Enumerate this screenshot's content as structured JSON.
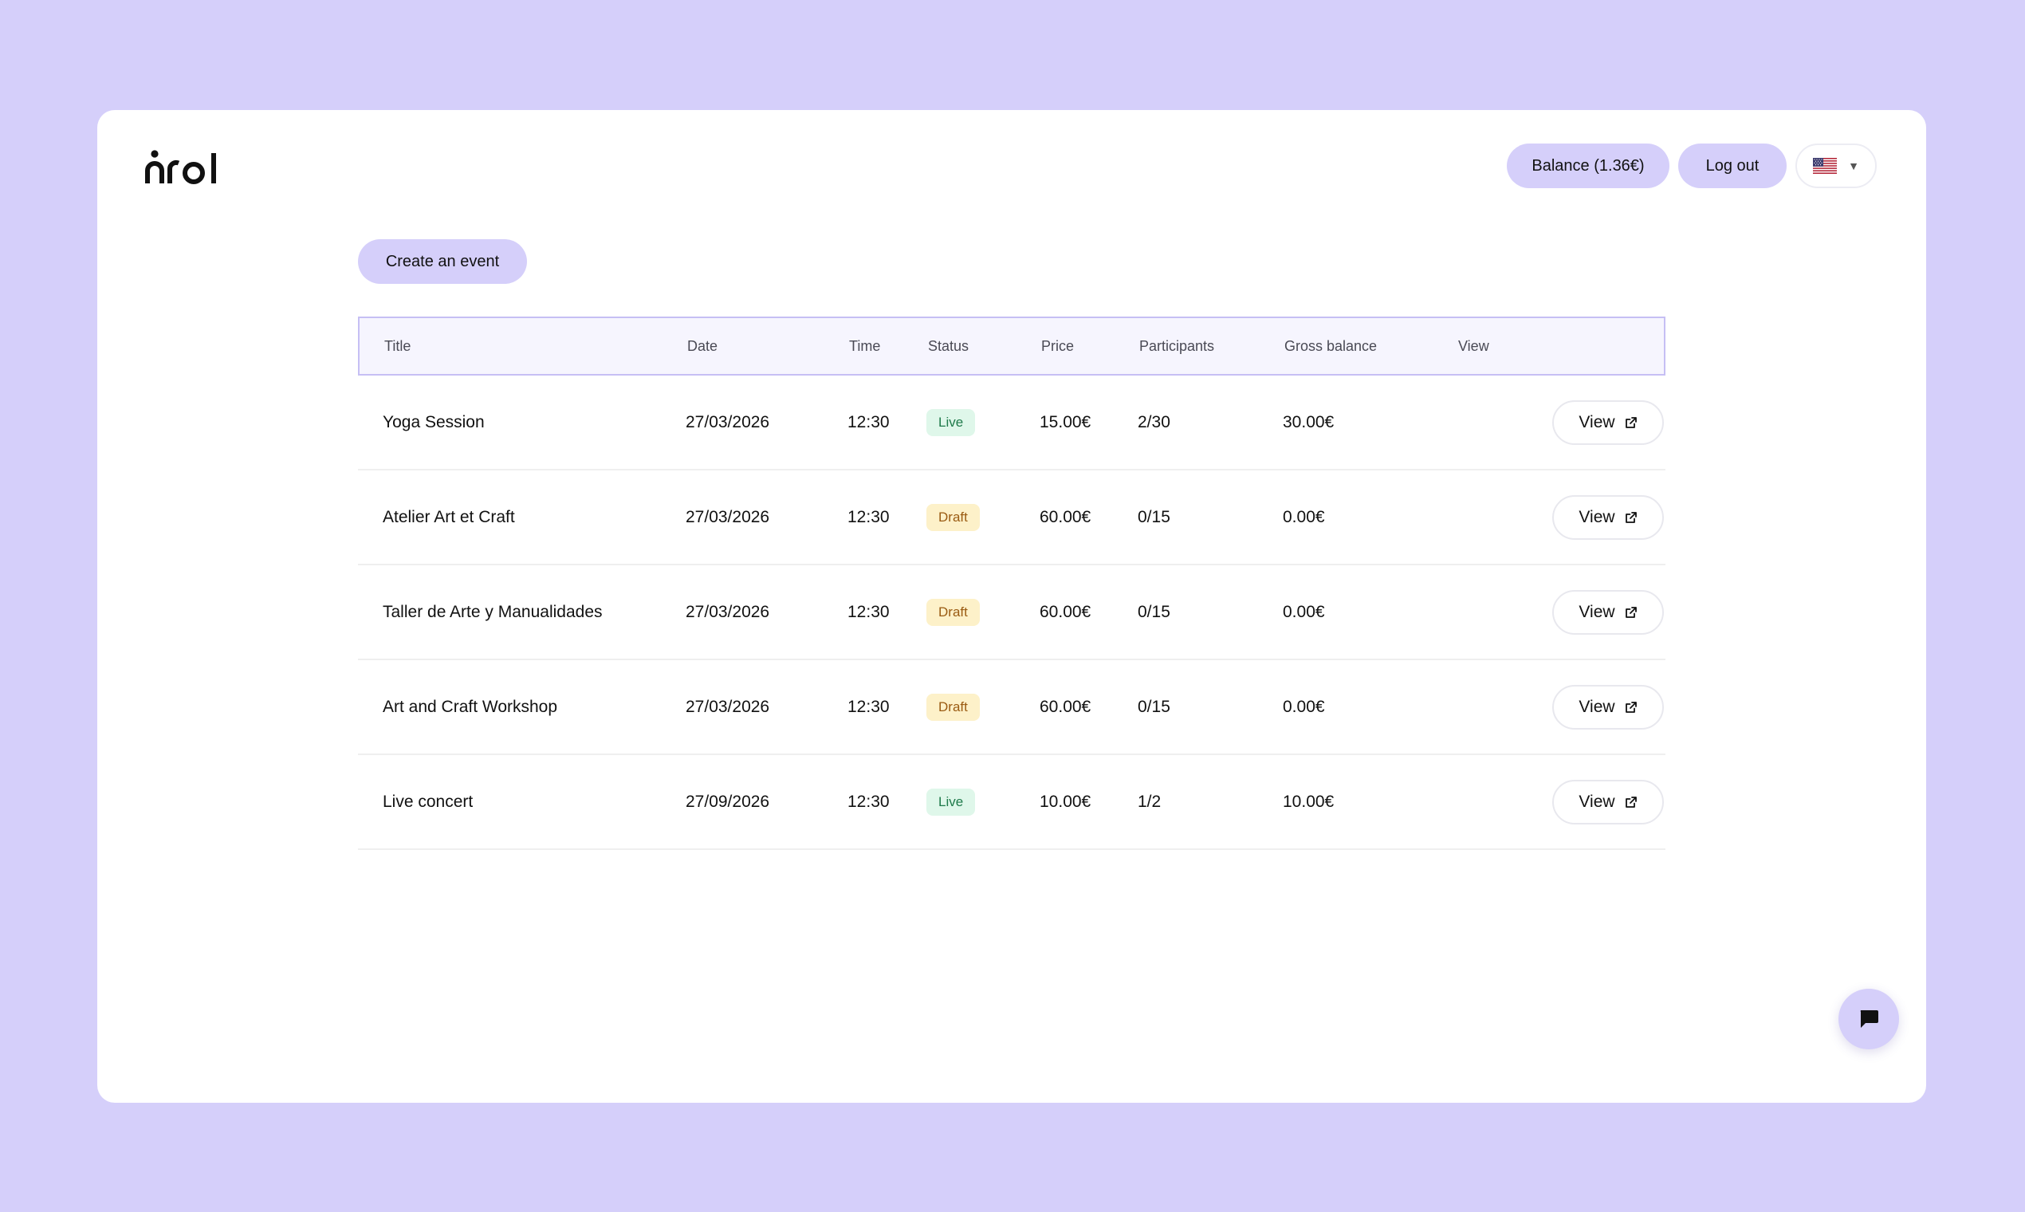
{
  "brand": {
    "name": "nrol"
  },
  "header": {
    "balance_label": "Balance (1.36€)",
    "logout_label": "Log out",
    "language_icon": "us-flag-icon"
  },
  "actions": {
    "create_label": "Create an event"
  },
  "table": {
    "columns": [
      "Title",
      "Date",
      "Time",
      "Status",
      "Price",
      "Participants",
      "Gross balance",
      "View"
    ],
    "rows": [
      {
        "title": "Yoga Session",
        "date": "27/03/2026",
        "time": "12:30",
        "status": "Live",
        "price": "15.00€",
        "participants": "2/30",
        "gross": "30.00€",
        "view_label": "View"
      },
      {
        "title": "Atelier Art et Craft",
        "date": "27/03/2026",
        "time": "12:30",
        "status": "Draft",
        "price": "60.00€",
        "participants": "0/15",
        "gross": "0.00€",
        "view_label": "View"
      },
      {
        "title": "Taller de Arte y Manualidades",
        "date": "27/03/2026",
        "time": "12:30",
        "status": "Draft",
        "price": "60.00€",
        "participants": "0/15",
        "gross": "0.00€",
        "view_label": "View"
      },
      {
        "title": "Art and Craft Workshop",
        "date": "27/03/2026",
        "time": "12:30",
        "status": "Draft",
        "price": "60.00€",
        "participants": "0/15",
        "gross": "0.00€",
        "view_label": "View"
      },
      {
        "title": "Live concert",
        "date": "27/09/2026",
        "time": "12:30",
        "status": "Live",
        "price": "10.00€",
        "participants": "1/2",
        "gross": "10.00€",
        "view_label": "View"
      }
    ]
  },
  "colors": {
    "background": "#d5cffa",
    "accent": "#d5cffa",
    "status_live_bg": "#dff7ea",
    "status_live_text": "#1e7a4a",
    "status_draft_bg": "#fdf1c9",
    "status_draft_text": "#9a5b12"
  },
  "chat": {
    "icon": "chat-bubble-icon"
  }
}
